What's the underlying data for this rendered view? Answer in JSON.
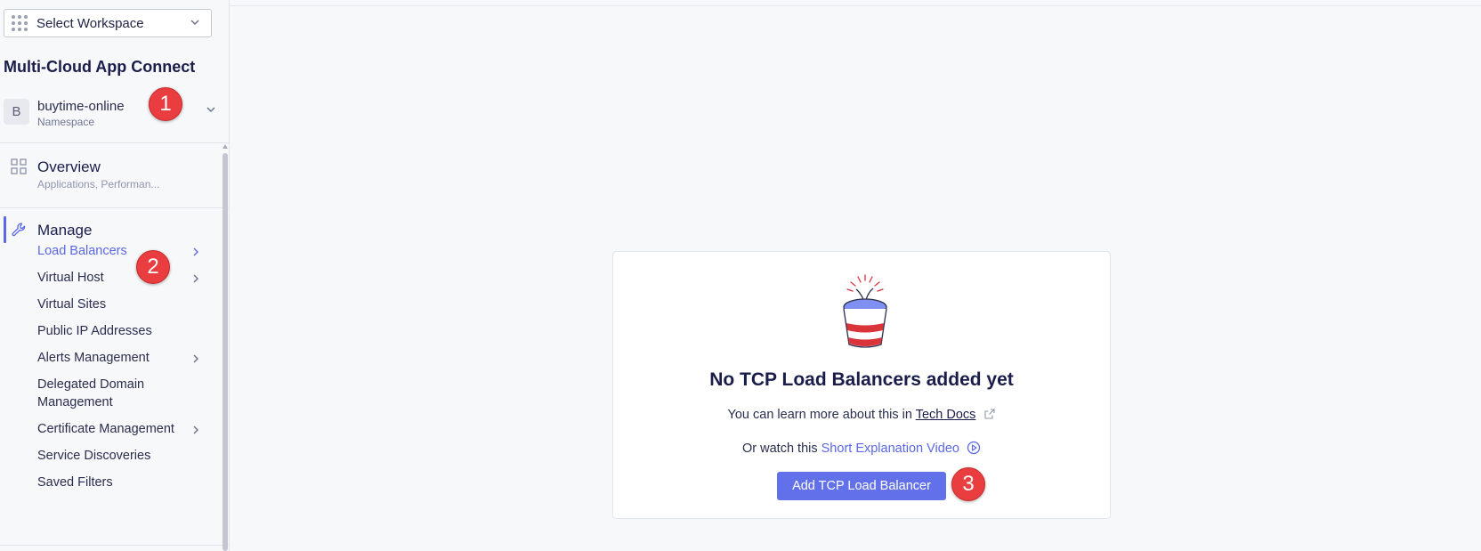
{
  "workspace": {
    "placeholder": "Select Workspace"
  },
  "app": {
    "title": "Multi-Cloud App Connect"
  },
  "namespace": {
    "avatar": "B",
    "name": "buytime-online",
    "label": "Namespace"
  },
  "overview": {
    "title": "Overview",
    "subtitle": "Applications, Performan..."
  },
  "manage": {
    "label": "Manage",
    "items": [
      {
        "label": "Load Balancers",
        "active": true,
        "has_submenu": true
      },
      {
        "label": "Virtual Host",
        "active": false,
        "has_submenu": true
      },
      {
        "label": "Virtual Sites",
        "active": false,
        "has_submenu": false
      },
      {
        "label": "Public IP Addresses",
        "active": false,
        "has_submenu": false
      },
      {
        "label": "Alerts Management",
        "active": false,
        "has_submenu": true
      },
      {
        "label": "Delegated Domain",
        "label_line2": "Management",
        "active": false,
        "has_submenu": false
      },
      {
        "label": "Certificate Management",
        "active": false,
        "has_submenu": true
      },
      {
        "label": "Service Discoveries",
        "active": false,
        "has_submenu": false
      },
      {
        "label": "Saved Filters",
        "active": false,
        "has_submenu": false
      }
    ]
  },
  "empty_state": {
    "title": "No TCP Load Balancers added yet",
    "learn_prefix": "You can learn more about this in",
    "learn_link": "Tech Docs",
    "watch_prefix": "Or watch this",
    "watch_link": "Short Explanation Video",
    "button_label": "Add TCP Load Balancer"
  },
  "annotations": [
    "1",
    "2",
    "3"
  ],
  "colors": {
    "accent": "#5a68e6",
    "button": "#6271ea",
    "badge": "#ea3d3f",
    "title": "#1a1d4a"
  }
}
